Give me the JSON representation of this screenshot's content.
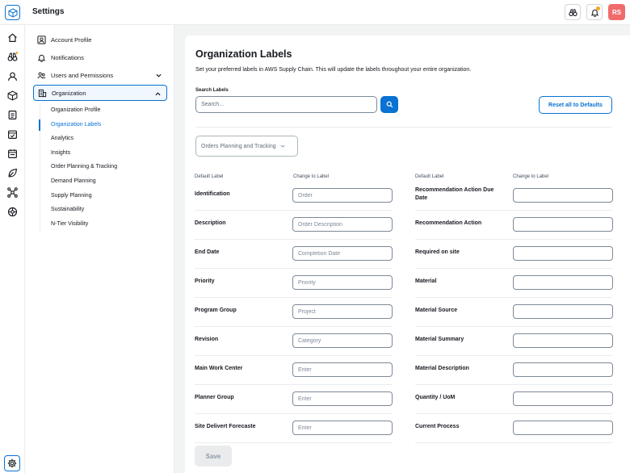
{
  "header": {
    "title": "Settings",
    "avatar_initials": "RS"
  },
  "rail": {
    "icons": [
      "home-icon",
      "binoculars-icon",
      "user-search-icon",
      "box-icon",
      "document-icon",
      "calendar-check-icon",
      "calendar-icon",
      "leaf-icon",
      "network-icon",
      "globe-icon"
    ],
    "settings_icon": "gear-icon"
  },
  "sidebar": {
    "account_profile": "Account Profile",
    "notifications": "Notifications",
    "users_permissions": "Users and Permissions",
    "organization": "Organization",
    "sub_items": [
      "Organization Profile",
      "Organization Labels",
      "Analytics",
      "Insights",
      "Order Planning & Tracking",
      "Demand Planning",
      "Supply Planning",
      "Sustainability",
      "N-Tier Visibility"
    ]
  },
  "main": {
    "title": "Organization Labels",
    "description": "Set your preferred labels in AWS Supply Chain. This will update the labels throughout your entire organization.",
    "search_label": "Search Labels",
    "search_placeholder": "Search...",
    "reset_label": "Reset all to Defaults",
    "module_select": "Orders Planning and Tracking",
    "col_default": "Default Label",
    "col_change": "Change to Label",
    "left_rows": [
      {
        "label": "Identification",
        "placeholder": "Order"
      },
      {
        "label": "Description",
        "placeholder": "Order Description"
      },
      {
        "label": "End Date",
        "placeholder": "Completion Date"
      },
      {
        "label": "Priority",
        "placeholder": "Priority"
      },
      {
        "label": "Program Group",
        "placeholder": "Project"
      },
      {
        "label": "Revision",
        "placeholder": "Category"
      },
      {
        "label": "Main Work Center",
        "placeholder": "Enter"
      },
      {
        "label": "Planner Group",
        "placeholder": "Enter"
      },
      {
        "label": "Site Delivert Forecaste",
        "placeholder": "Enter"
      }
    ],
    "right_rows": [
      {
        "label": "Recommendation Action Due Date",
        "placeholder": ""
      },
      {
        "label": "Recommendation Action",
        "placeholder": ""
      },
      {
        "label": "Required on site",
        "placeholder": ""
      },
      {
        "label": "Material",
        "placeholder": ""
      },
      {
        "label": "Material Source",
        "placeholder": ""
      },
      {
        "label": "Material Summary",
        "placeholder": ""
      },
      {
        "label": "Material Description",
        "placeholder": ""
      },
      {
        "label": "Quantity / UoM",
        "placeholder": ""
      },
      {
        "label": "Current Process",
        "placeholder": ""
      }
    ],
    "save_label": "Save"
  },
  "colors": {
    "accent": "#0972d3",
    "avatar": "#f06c6c",
    "notification_dot": "#f5a623"
  }
}
